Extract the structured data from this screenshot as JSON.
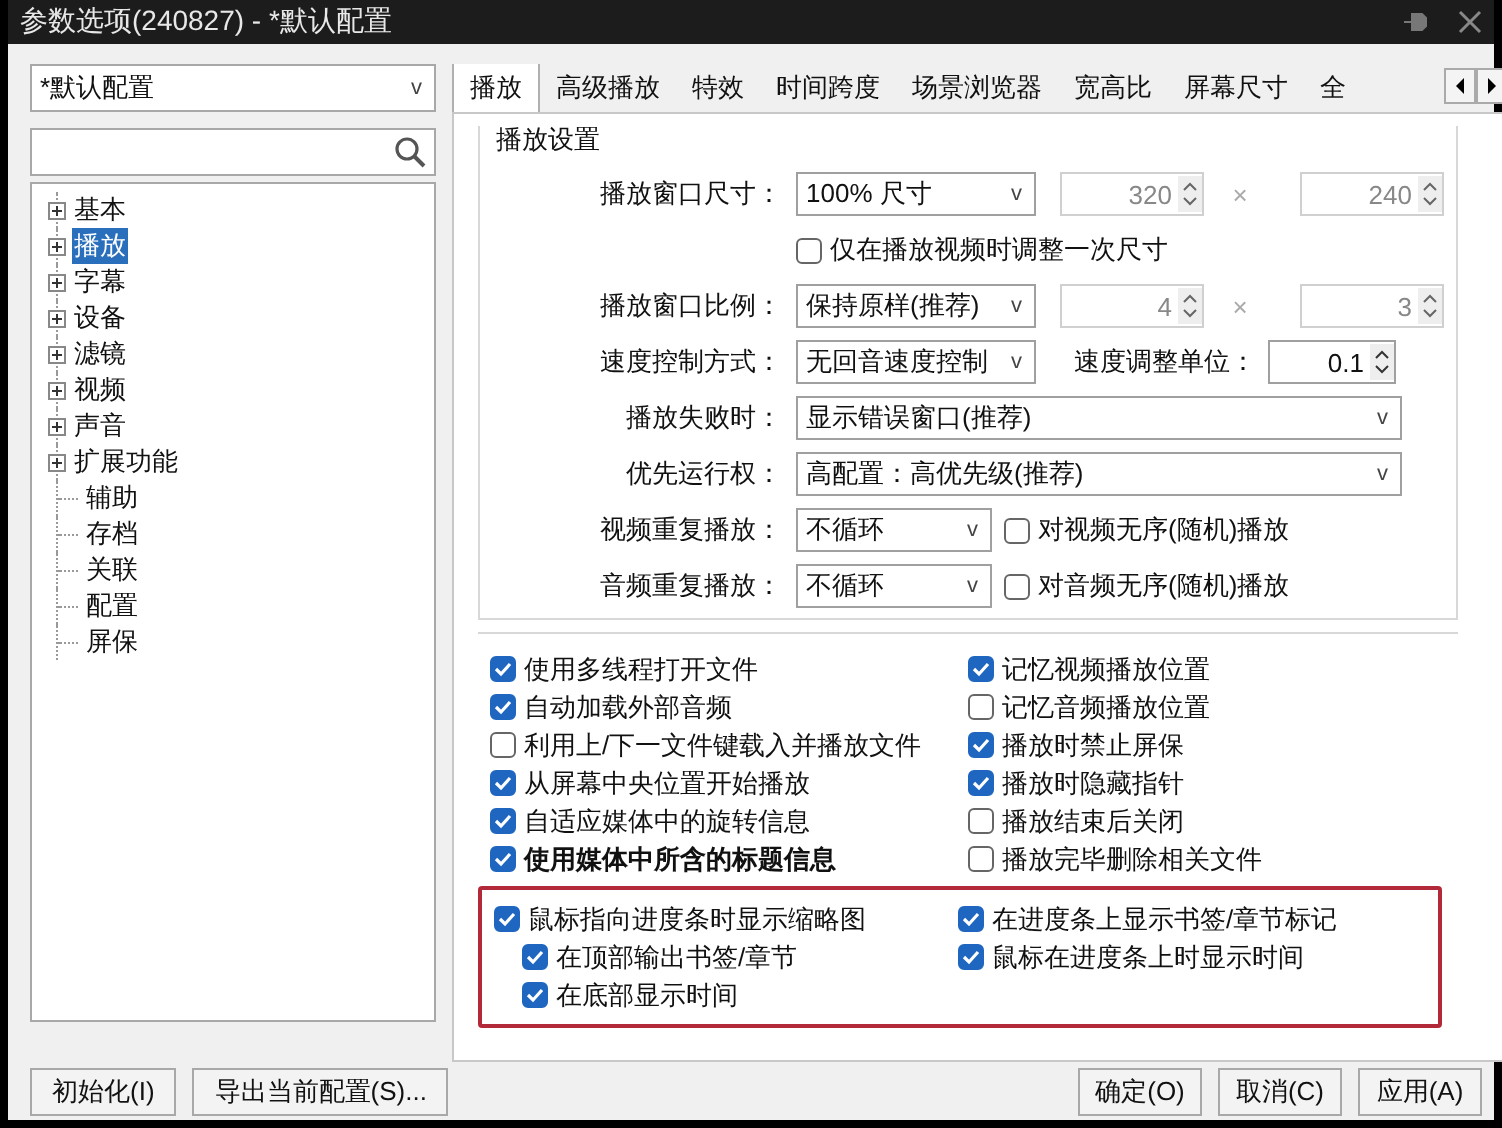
{
  "window": {
    "title": "参数选项(240827) - *默认配置"
  },
  "profile_select": {
    "value": "*默认配置",
    "arrow": "v"
  },
  "tree": [
    {
      "label": "基本",
      "kind": "group",
      "selected": false
    },
    {
      "label": "播放",
      "kind": "group",
      "selected": true
    },
    {
      "label": "字幕",
      "kind": "group",
      "selected": false
    },
    {
      "label": "设备",
      "kind": "group",
      "selected": false
    },
    {
      "label": "滤镜",
      "kind": "group",
      "selected": false
    },
    {
      "label": "视频",
      "kind": "group",
      "selected": false
    },
    {
      "label": "声音",
      "kind": "group",
      "selected": false
    },
    {
      "label": "扩展功能",
      "kind": "group",
      "selected": false
    },
    {
      "label": "辅助",
      "kind": "leaf",
      "selected": false
    },
    {
      "label": "存档",
      "kind": "leaf",
      "selected": false
    },
    {
      "label": "关联",
      "kind": "leaf",
      "selected": false
    },
    {
      "label": "配置",
      "kind": "leaf",
      "selected": false
    },
    {
      "label": "屏保",
      "kind": "leaf",
      "selected": false
    }
  ],
  "tabs": [
    {
      "label": "播放",
      "selected": true
    },
    {
      "label": "高级播放",
      "selected": false
    },
    {
      "label": "特效",
      "selected": false
    },
    {
      "label": "时间跨度",
      "selected": false
    },
    {
      "label": "场景浏览器",
      "selected": false
    },
    {
      "label": "宽高比",
      "selected": false
    },
    {
      "label": "屏幕尺寸",
      "selected": false
    },
    {
      "label": "全",
      "selected": false
    }
  ],
  "group_title": "播放设置",
  "form": [
    {
      "kind": "size",
      "label": "播放窗口尺寸：",
      "select": "100% 尺寸",
      "arrow": "v",
      "a": "320",
      "sep": "×",
      "b": "240",
      "disabled": true
    },
    {
      "kind": "checkbox",
      "text": "仅在播放视频时调整一次尺寸",
      "checked": false
    },
    {
      "kind": "size",
      "label": "播放窗口比例：",
      "select": "保持原样(推荐)",
      "arrow": "v",
      "a": "4",
      "sep": "×",
      "b": "3",
      "disabled": true
    },
    {
      "kind": "speed",
      "label": "速度控制方式：",
      "select": "无回音速度控制",
      "arrow": "v",
      "sublabel": "速度调整单位：",
      "value": "0.1"
    },
    {
      "kind": "wide",
      "label": "播放失败时：",
      "select": "显示错误窗口(推荐)",
      "arrow": "v"
    },
    {
      "kind": "wide",
      "label": "优先运行权：",
      "select": "高配置：高优先级(推荐)",
      "arrow": "v"
    },
    {
      "kind": "repeat",
      "label": "视频重复播放：",
      "select": "不循环",
      "arrow": "v",
      "text": "对视频无序(随机)播放",
      "checked": false
    },
    {
      "kind": "repeat",
      "label": "音频重复播放：",
      "select": "不循环",
      "arrow": "v",
      "text": "对音频无序(随机)播放",
      "checked": false
    }
  ],
  "options_left": [
    {
      "text": "使用多线程打开文件",
      "checked": true,
      "emphasis": false
    },
    {
      "text": "自动加载外部音频",
      "checked": true,
      "emphasis": false
    },
    {
      "text": "利用上/下一文件键载入并播放文件",
      "checked": false,
      "emphasis": false
    },
    {
      "text": "从屏幕中央位置开始播放",
      "checked": true,
      "emphasis": false
    },
    {
      "text": "自适应媒体中的旋转信息",
      "checked": true,
      "emphasis": false
    },
    {
      "text": "使用媒体中所含的标题信息",
      "checked": true,
      "emphasis": true
    }
  ],
  "options_right": [
    {
      "text": "记忆视频播放位置",
      "checked": true,
      "emphasis": false
    },
    {
      "text": "记忆音频播放位置",
      "checked": false,
      "emphasis": false
    },
    {
      "text": "播放时禁止屏保",
      "checked": true,
      "emphasis": false
    },
    {
      "text": "播放时隐藏指针",
      "checked": true,
      "emphasis": false
    },
    {
      "text": "播放结束后关闭",
      "checked": false,
      "emphasis": false
    },
    {
      "text": "播放完毕删除相关文件",
      "checked": false,
      "emphasis": false
    }
  ],
  "seek_left": [
    {
      "text": "鼠标指向进度条时显示缩略图",
      "checked": true,
      "children": [
        {
          "text": "在顶部输出书签/章节",
          "checked": true
        },
        {
          "text": "在底部显示时间",
          "checked": true
        }
      ]
    }
  ],
  "seek_right": [
    {
      "text": "在进度条上显示书签/章节标记",
      "checked": true
    },
    {
      "text": "鼠标在进度条上时显示时间",
      "checked": true
    }
  ],
  "buttons_left": [
    "初始化(I)",
    "导出当前配置(S)..."
  ],
  "buttons_right": [
    "确定(O)",
    "取消(C)",
    "应用(A)"
  ]
}
